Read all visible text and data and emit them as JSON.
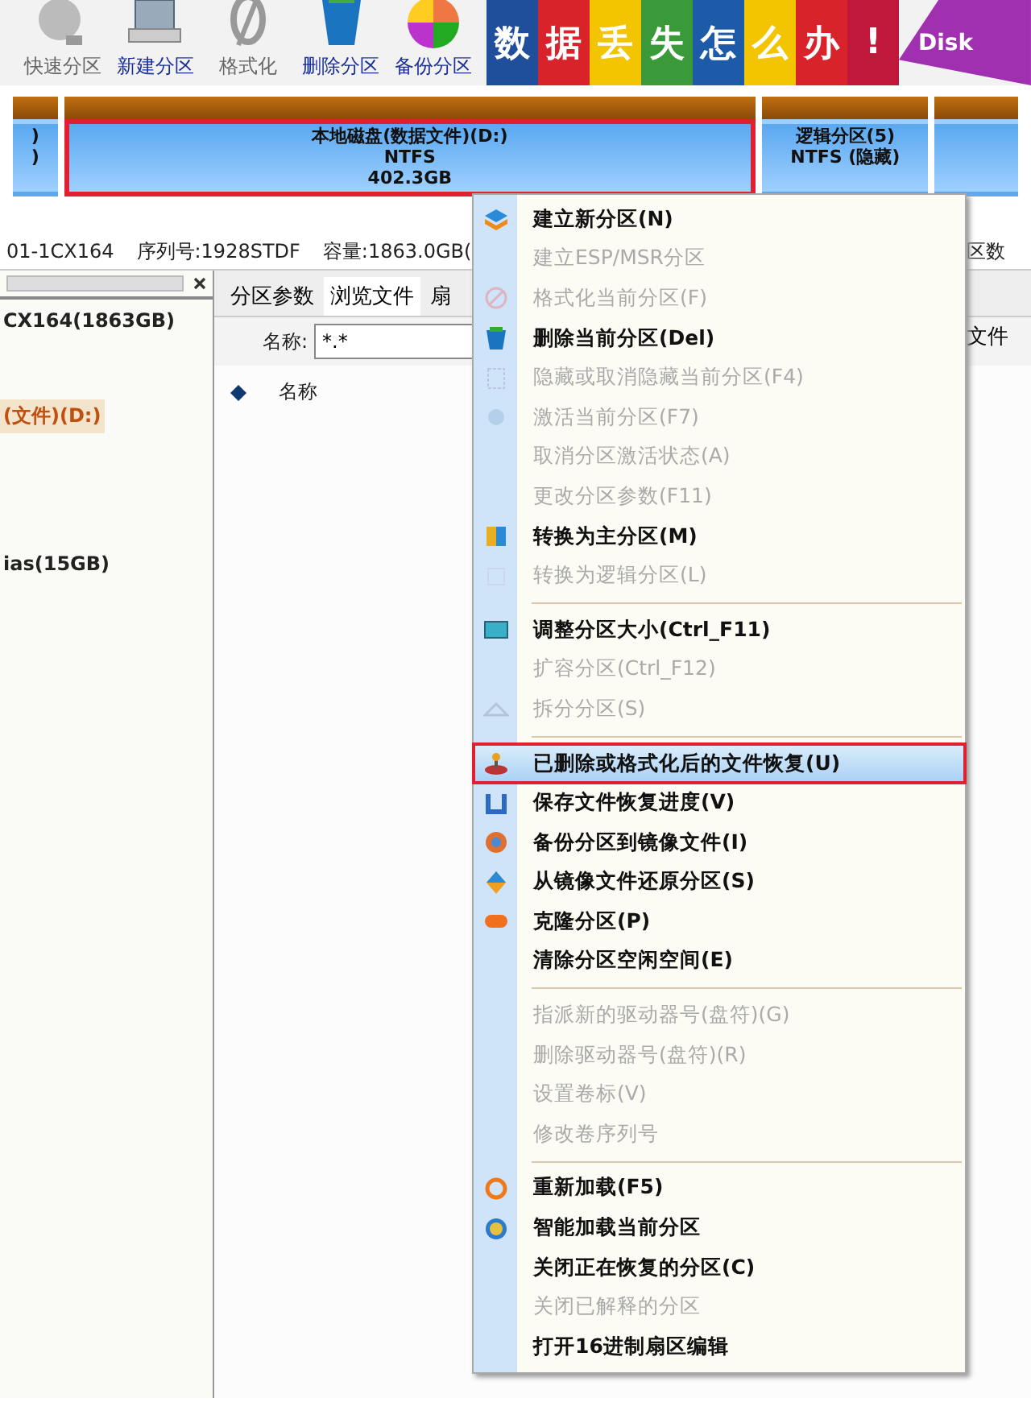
{
  "toolbar": {
    "buttons": [
      {
        "label": "快速分区",
        "disabled": true
      },
      {
        "label": "新建分区",
        "disabled": false
      },
      {
        "label": "格式化",
        "disabled": true
      },
      {
        "label": "删除分区",
        "disabled": false
      },
      {
        "label": "备份分区",
        "disabled": false
      }
    ],
    "banner": [
      {
        "char": "数",
        "color": "#1f4f9a"
      },
      {
        "char": "据",
        "color": "#d8232a"
      },
      {
        "char": "丢",
        "color": "#f2c500"
      },
      {
        "char": "失",
        "color": "#3a9a3a"
      },
      {
        "char": "怎",
        "color": "#1d5aa8"
      },
      {
        "char": "么",
        "color": "#f2c500"
      },
      {
        "char": "办",
        "color": "#d8232a"
      },
      {
        "char": "!",
        "color": "#c0183a"
      }
    ],
    "banner_logo": "Disk"
  },
  "disk_map": {
    "partitions": [
      {
        "lines": [
          ")",
          ")"
        ],
        "selected": false
      },
      {
        "lines": [
          "本地磁盘(数据文件)(D:)",
          "NTFS",
          "402.3GB"
        ],
        "selected": true
      },
      {
        "lines": [
          "逻辑分区(5)",
          "NTFS (隐藏)"
        ],
        "selected": false
      },
      {
        "selected": false
      }
    ]
  },
  "disk_info": [
    "01-1CX164",
    "序列号:1928STDF",
    "容量:1863.0GB("
  ],
  "disk_info_right": "区数",
  "tree": {
    "items": [
      {
        "label": "CX164(1863GB)",
        "selected": false
      },
      {
        "label": "(文件)(D:)",
        "selected": true
      },
      {
        "label": "ias(15GB)",
        "selected": false
      }
    ]
  },
  "tabs": [
    {
      "label": "分区参数",
      "selected": false
    },
    {
      "label": "浏览文件",
      "selected": true
    },
    {
      "label": "扇",
      "selected": false
    }
  ],
  "filter": {
    "label": "名称:",
    "value": "*.*"
  },
  "filter_button": "文件",
  "list_header": "名称",
  "context_menu": {
    "items": [
      {
        "kind": "item",
        "label": "建立新分区(N)",
        "disabled": false,
        "selected": false
      },
      {
        "kind": "item",
        "label": "建立ESP/MSR分区",
        "disabled": true,
        "selected": false
      },
      {
        "kind": "item",
        "label": "格式化当前分区(F)",
        "disabled": true,
        "selected": false
      },
      {
        "kind": "item",
        "label": "删除当前分区(Del)",
        "disabled": false,
        "selected": false
      },
      {
        "kind": "item",
        "label": "隐藏或取消隐藏当前分区(F4)",
        "disabled": true,
        "selected": false
      },
      {
        "kind": "item",
        "label": "激活当前分区(F7)",
        "disabled": true,
        "selected": false
      },
      {
        "kind": "item",
        "label": "取消分区激活状态(A)",
        "disabled": true,
        "selected": false
      },
      {
        "kind": "item",
        "label": "更改分区参数(F11)",
        "disabled": true,
        "selected": false
      },
      {
        "kind": "item",
        "label": "转换为主分区(M)",
        "disabled": false,
        "selected": false
      },
      {
        "kind": "item",
        "label": "转换为逻辑分区(L)",
        "disabled": true,
        "selected": false
      },
      {
        "kind": "separator"
      },
      {
        "kind": "item",
        "label": "调整分区大小(Ctrl_F11)",
        "disabled": false,
        "selected": false
      },
      {
        "kind": "item",
        "label": "扩容分区(Ctrl_F12)",
        "disabled": true,
        "selected": false
      },
      {
        "kind": "item",
        "label": "拆分分区(S)",
        "disabled": true,
        "selected": false
      },
      {
        "kind": "separator"
      },
      {
        "kind": "item",
        "label": "已删除或格式化后的文件恢复(U)",
        "disabled": false,
        "selected": true
      },
      {
        "kind": "item",
        "label": "保存文件恢复进度(V)",
        "disabled": false,
        "selected": false
      },
      {
        "kind": "item",
        "label": "备份分区到镜像文件(I)",
        "disabled": false,
        "selected": false
      },
      {
        "kind": "item",
        "label": "从镜像文件还原分区(S)",
        "disabled": false,
        "selected": false
      },
      {
        "kind": "item",
        "label": "克隆分区(P)",
        "disabled": false,
        "selected": false
      },
      {
        "kind": "item",
        "label": "清除分区空闲空间(E)",
        "disabled": false,
        "selected": false
      },
      {
        "kind": "separator"
      },
      {
        "kind": "item",
        "label": "指派新的驱动器号(盘符)(G)",
        "disabled": true,
        "selected": false
      },
      {
        "kind": "item",
        "label": "删除驱动器号(盘符)(R)",
        "disabled": true,
        "selected": false
      },
      {
        "kind": "item",
        "label": "设置卷标(V)",
        "disabled": true,
        "selected": false
      },
      {
        "kind": "item",
        "label": "修改卷序列号",
        "disabled": true,
        "selected": false
      },
      {
        "kind": "separator"
      },
      {
        "kind": "item",
        "label": "重新加载(F5)",
        "disabled": false,
        "selected": false
      },
      {
        "kind": "item",
        "label": "智能加载当前分区",
        "disabled": false,
        "selected": false
      },
      {
        "kind": "item",
        "label": "关闭正在恢复的分区(C)",
        "disabled": false,
        "selected": false
      },
      {
        "kind": "item",
        "label": "关闭已解释的分区",
        "disabled": true,
        "selected": false
      },
      {
        "kind": "item",
        "label": "打开16进制扇区编辑",
        "disabled": false,
        "selected": false
      }
    ]
  }
}
